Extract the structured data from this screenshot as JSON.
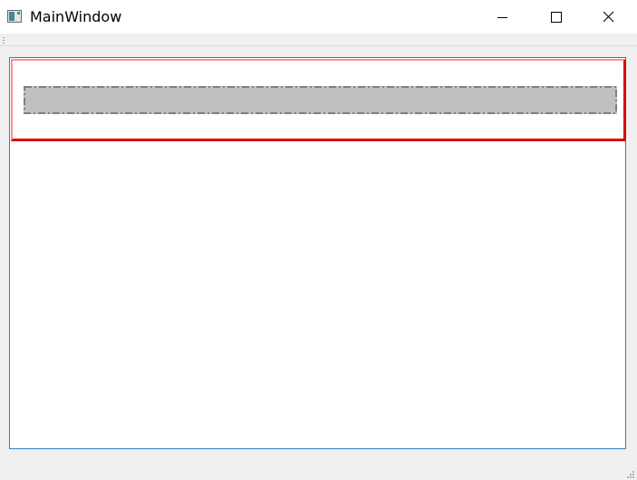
{
  "window": {
    "title": "MainWindow",
    "caption_buttons": {
      "minimize": "minimize-icon",
      "maximize": "maximize-icon",
      "close": "close-icon"
    }
  },
  "colors": {
    "central_border": "#2a7fc9",
    "frame_red": "#e00000",
    "frame_light_red": "#ff8f8f",
    "bar_fill": "#c0c0c0",
    "bar_dash": "#808080"
  }
}
